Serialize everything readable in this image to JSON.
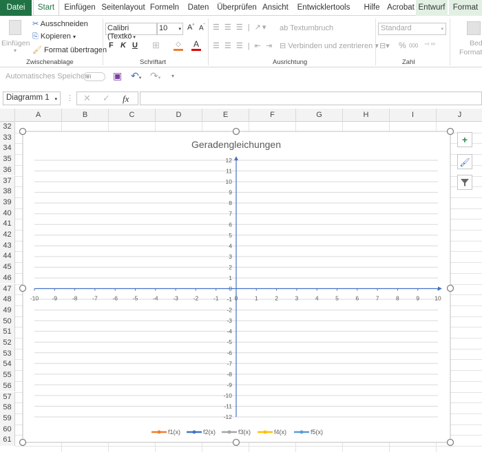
{
  "tabs": [
    {
      "label": "Datei",
      "active": false
    },
    {
      "label": "Start",
      "active": true
    },
    {
      "label": "Einfügen"
    },
    {
      "label": "Seitenlayout"
    },
    {
      "label": "Formeln"
    },
    {
      "label": "Daten"
    },
    {
      "label": "Überprüfen"
    },
    {
      "label": "Ansicht"
    },
    {
      "label": "Entwicklertools"
    },
    {
      "label": "Hilfe"
    },
    {
      "label": "Acrobat"
    },
    {
      "label": "Entwurf"
    },
    {
      "label": "Format"
    }
  ],
  "ribbon": {
    "clipboard": {
      "paste": "Einfügen",
      "cut": "Ausschneiden",
      "copy": "Kopieren",
      "format_painter": "Format übertragen",
      "group": "Zwischenablage"
    },
    "font": {
      "name": "Calibri (Textkö",
      "size": "10",
      "bold": "F",
      "italic": "K",
      "underline": "U",
      "font_color_glyph": "A",
      "group": "Schriftart"
    },
    "alignment": {
      "wrap": "Textumbruch",
      "merge": "Verbinden und zentrieren",
      "group": "Ausrichtung"
    },
    "number": {
      "format": "Standard",
      "percent": "%",
      "thousands": "000",
      "group": "Zahl"
    },
    "styles": {
      "conditional_1": "Beding",
      "conditional_2": "Formatien"
    }
  },
  "qat": {
    "autosave": "Automatisches Speichern"
  },
  "formula_bar": {
    "name_box": "Diagramm 1",
    "fx": "fx",
    "value": ""
  },
  "columns": [
    "A",
    "B",
    "C",
    "D",
    "E",
    "F",
    "G",
    "H",
    "I",
    "J"
  ],
  "rows": [
    "32",
    "33",
    "34",
    "35",
    "36",
    "37",
    "38",
    "39",
    "40",
    "41",
    "42",
    "43",
    "44",
    "45",
    "46",
    "47",
    "48",
    "49",
    "50",
    "51",
    "52",
    "53",
    "54",
    "55",
    "56",
    "57",
    "58",
    "59",
    "60",
    "61"
  ],
  "chart_data": {
    "type": "line",
    "title": "Geradengleichungen",
    "xlim": [
      -10,
      10
    ],
    "ylim": [
      -12,
      12
    ],
    "x_ticks": [
      -10,
      -9,
      -8,
      -7,
      -6,
      -5,
      -4,
      -3,
      -2,
      -1,
      0,
      1,
      2,
      3,
      4,
      5,
      6,
      7,
      8,
      9,
      10
    ],
    "y_ticks": [
      12,
      11,
      10,
      9,
      8,
      7,
      6,
      5,
      4,
      3,
      2,
      1,
      0,
      -1,
      -2,
      -3,
      -4,
      -5,
      -6,
      -7,
      -8,
      -9,
      -10,
      -11,
      -12
    ],
    "grid": "horizontal",
    "legend_position": "bottom",
    "series": [
      {
        "name": "f1(x)",
        "color": "#ed7d31",
        "values": []
      },
      {
        "name": "f2(x)",
        "color": "#4472c4",
        "values": []
      },
      {
        "name": "f3(x)",
        "color": "#a5a5a5",
        "values": []
      },
      {
        "name": "f4(x)",
        "color": "#ffc000",
        "values": []
      },
      {
        "name": "f5(x)",
        "color": "#5b9bd5",
        "values": []
      }
    ],
    "axis_color": "#4472c4"
  },
  "chart_buttons": {
    "add": "+"
  }
}
